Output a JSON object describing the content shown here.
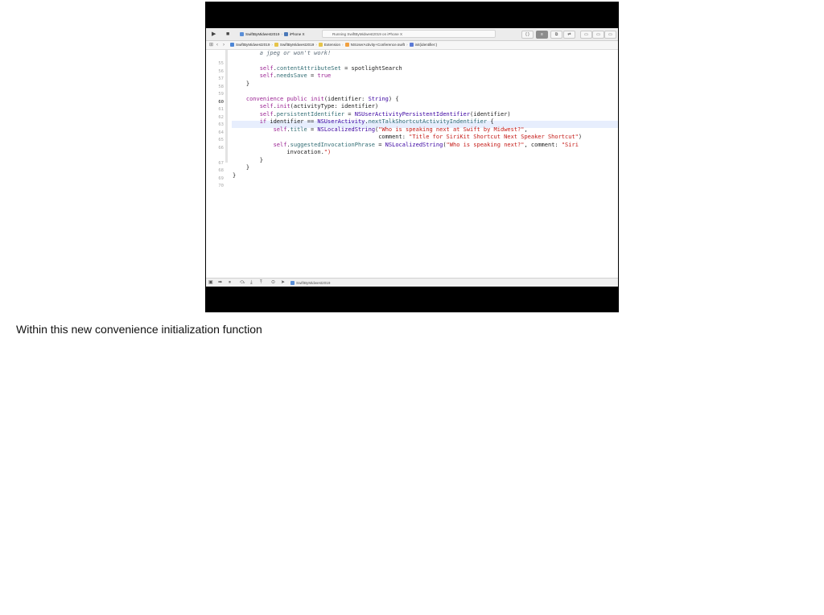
{
  "toolbar": {
    "run_icon": "play-icon",
    "stop_icon": "stop-icon",
    "scheme_target": "SwiftByMidwest2019",
    "scheme_device": "iPhone X",
    "status_text": "Running SwiftByMidwest2019 on iPhone X",
    "right_buttons": [
      "{ }",
      "≡",
      "⧉",
      "⇄",
      "▭",
      "▭",
      "▭"
    ]
  },
  "jumpbar": {
    "crumbs": [
      "SwiftByMidwest2019",
      "SwiftByMidwest2019",
      "Extension",
      "NSUserActivity+Conference.swift",
      "init(identifier:)"
    ]
  },
  "editor": {
    "line_numbers": [
      "55",
      "56",
      "57",
      "58",
      "59",
      "60",
      "61",
      "62",
      "63",
      "64",
      "65",
      "66",
      "",
      "67",
      "68",
      "69",
      "70"
    ],
    "current_line": "60",
    "lines": [
      "        a jpeg or won't work!",
      "",
      "        self.contentAttributeSet = spotlightSearch",
      "        self.needsSave = true",
      "    }",
      "",
      "    convenience public init(identifier: String) {",
      "        self.init(activityType: identifier)",
      "        self.persistentIdentifier = NSUserActivityPersistentIdentifier(identifier)",
      "        if identifier == NSUserActivity.nextTalkShortcutActivityIndentifier {",
      "            self.title = NSLocalizedString(\"Who is speaking next at Swift by Midwest?\",",
      "                                           comment: \"Title for SiriKit Shortcut Next Speaker Shortcut\")",
      "            self.suggestedInvocationPhrase = NSLocalizedString(\"Who is speaking next?\", comment: \"Siri",
      "                invocation.\")",
      "        }",
      "    }",
      "}"
    ]
  },
  "debugbar": {
    "target": "SwiftByMidwest2019"
  },
  "caption": "Within this new convenience initialization function"
}
